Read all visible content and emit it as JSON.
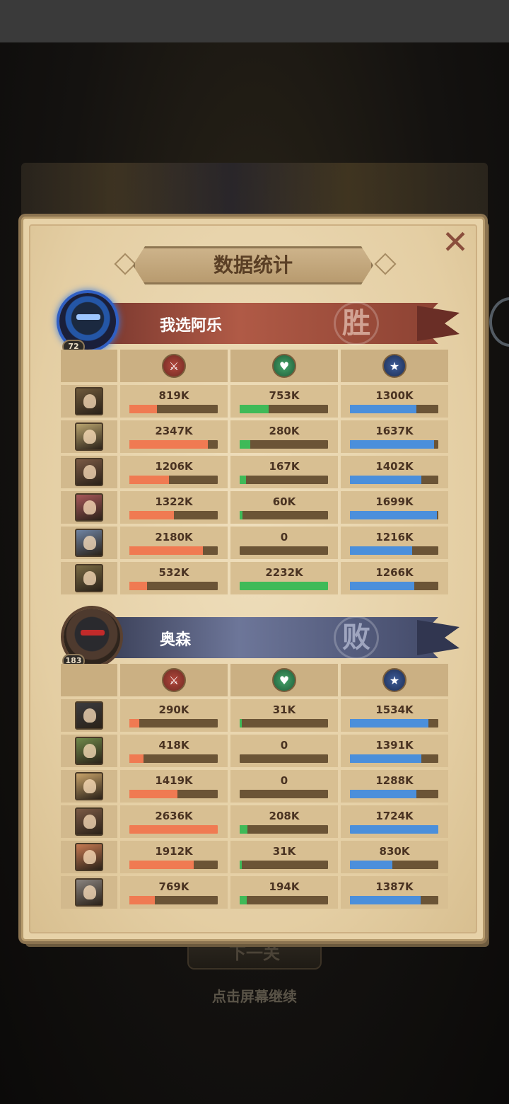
{
  "title": "数据统计",
  "buttons": {
    "next": "下一关"
  },
  "hint": "点击屏幕继续",
  "colors": {
    "damage": "#f07a52",
    "heal": "#3fba58",
    "tank": "#4b8fdb",
    "panel": "#e7d2a8"
  },
  "stat_icons": [
    "sword-icon",
    "heart-plus-icon",
    "shield-icon"
  ],
  "teams": [
    {
      "name": "我选阿乐",
      "level": "72",
      "result": "胜",
      "heroes": [
        {
          "portrait": "#6f5a3b",
          "damage": "819K",
          "heal": "753K",
          "tank": "1300K",
          "damage_fill": 0.31,
          "heal_fill": 0.33,
          "tank_fill": 0.75
        },
        {
          "portrait": "#b9a46e",
          "damage": "2347K",
          "heal": "280K",
          "tank": "1637K",
          "damage_fill": 0.89,
          "heal_fill": 0.12,
          "tank_fill": 0.95
        },
        {
          "portrait": "#7b5a45",
          "damage": "1206K",
          "heal": "167K",
          "tank": "1402K",
          "damage_fill": 0.45,
          "heal_fill": 0.07,
          "tank_fill": 0.81
        },
        {
          "portrait": "#a8585a",
          "damage": "1322K",
          "heal": "60K",
          "tank": "1699K",
          "damage_fill": 0.5,
          "heal_fill": 0.03,
          "tank_fill": 0.98
        },
        {
          "portrait": "#6f84a4",
          "damage": "2180K",
          "heal": "0",
          "tank": "1216K",
          "damage_fill": 0.83,
          "heal_fill": 0.0,
          "tank_fill": 0.7
        },
        {
          "portrait": "#7a6b44",
          "damage": "532K",
          "heal": "2232K",
          "tank": "1266K",
          "damage_fill": 0.2,
          "heal_fill": 1.0,
          "tank_fill": 0.73
        }
      ]
    },
    {
      "name": "奥森",
      "level": "183",
      "result": "败",
      "heroes": [
        {
          "portrait": "#3b3b3f",
          "damage": "290K",
          "heal": "31K",
          "tank": "1534K",
          "damage_fill": 0.11,
          "heal_fill": 0.02,
          "tank_fill": 0.89
        },
        {
          "portrait": "#6f8a4a",
          "damage": "418K",
          "heal": "0",
          "tank": "1391K",
          "damage_fill": 0.16,
          "heal_fill": 0.0,
          "tank_fill": 0.81
        },
        {
          "portrait": "#c9a46a",
          "damage": "1419K",
          "heal": "0",
          "tank": "1288K",
          "damage_fill": 0.54,
          "heal_fill": 0.0,
          "tank_fill": 0.75
        },
        {
          "portrait": "#7b5a45",
          "damage": "2636K",
          "heal": "208K",
          "tank": "1724K",
          "damage_fill": 1.0,
          "heal_fill": 0.09,
          "tank_fill": 1.0
        },
        {
          "portrait": "#c87a52",
          "damage": "1912K",
          "heal": "31K",
          "tank": "830K",
          "damage_fill": 0.73,
          "heal_fill": 0.02,
          "tank_fill": 0.48
        },
        {
          "portrait": "#8a8480",
          "damage": "769K",
          "heal": "194K",
          "tank": "1387K",
          "damage_fill": 0.29,
          "heal_fill": 0.08,
          "tank_fill": 0.8
        }
      ]
    }
  ]
}
